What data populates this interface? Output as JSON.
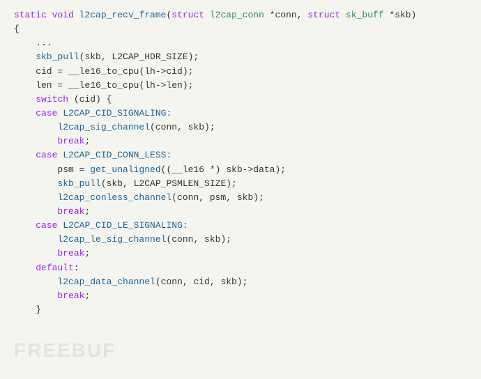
{
  "code": {
    "lines": [
      {
        "id": "line1",
        "tokens": [
          {
            "t": "static ",
            "c": "kw"
          },
          {
            "t": "void ",
            "c": "kw"
          },
          {
            "t": "l2cap_recv_frame",
            "c": "fn"
          },
          {
            "t": "(",
            "c": "plain"
          },
          {
            "t": "struct ",
            "c": "kw"
          },
          {
            "t": "l2cap_conn",
            "c": "type"
          },
          {
            "t": " *conn, ",
            "c": "plain"
          },
          {
            "t": "struct ",
            "c": "kw"
          },
          {
            "t": "sk_buff",
            "c": "type"
          },
          {
            "t": " *skb)",
            "c": "plain"
          }
        ]
      },
      {
        "id": "line2",
        "tokens": [
          {
            "t": "{",
            "c": "plain"
          }
        ]
      },
      {
        "id": "line3",
        "tokens": [
          {
            "t": "    ...",
            "c": "plain"
          }
        ]
      },
      {
        "id": "line4",
        "tokens": [
          {
            "t": "    skb_pull",
            "c": "fn"
          },
          {
            "t": "(skb, L2CAP_HDR_SIZE);",
            "c": "plain"
          }
        ]
      },
      {
        "id": "line5",
        "tokens": [
          {
            "t": "    cid = __le16_to_cpu",
            "c": "plain"
          },
          {
            "t": "(lh->cid);",
            "c": "plain"
          }
        ]
      },
      {
        "id": "line6",
        "tokens": [
          {
            "t": "    len = __le16_to_cpu",
            "c": "plain"
          },
          {
            "t": "(lh->len);",
            "c": "plain"
          }
        ]
      },
      {
        "id": "line7",
        "tokens": [
          {
            "t": "",
            "c": "plain"
          }
        ]
      },
      {
        "id": "line8",
        "tokens": [
          {
            "t": "    ",
            "c": "plain"
          },
          {
            "t": "switch",
            "c": "kw"
          },
          {
            "t": " (cid) {",
            "c": "plain"
          }
        ]
      },
      {
        "id": "line9",
        "tokens": [
          {
            "t": "    ",
            "c": "plain"
          },
          {
            "t": "case",
            "c": "kw"
          },
          {
            "t": " L2CAP_CID_SIGNALING:",
            "c": "const"
          }
        ]
      },
      {
        "id": "line10",
        "tokens": [
          {
            "t": "        l2cap_sig_channel",
            "c": "fn"
          },
          {
            "t": "(conn, skb);",
            "c": "plain"
          }
        ]
      },
      {
        "id": "line11",
        "tokens": [
          {
            "t": "        ",
            "c": "plain"
          },
          {
            "t": "break",
            "c": "kw"
          },
          {
            "t": ";",
            "c": "plain"
          }
        ]
      },
      {
        "id": "line12",
        "tokens": [
          {
            "t": "",
            "c": "plain"
          }
        ]
      },
      {
        "id": "line13",
        "tokens": [
          {
            "t": "    ",
            "c": "plain"
          },
          {
            "t": "case",
            "c": "kw"
          },
          {
            "t": " L2CAP_CID_CONN_LESS:",
            "c": "const"
          }
        ]
      },
      {
        "id": "line14",
        "tokens": [
          {
            "t": "        psm = ",
            "c": "plain"
          },
          {
            "t": "get_unaligned",
            "c": "fn"
          },
          {
            "t": "((__le16 *) skb->data);",
            "c": "plain"
          }
        ]
      },
      {
        "id": "line15",
        "tokens": [
          {
            "t": "        skb_pull",
            "c": "fn"
          },
          {
            "t": "(skb, L2CAP_PSMLEN_SIZE);",
            "c": "plain"
          }
        ]
      },
      {
        "id": "line16",
        "tokens": [
          {
            "t": "        l2cap_conless_channel",
            "c": "fn"
          },
          {
            "t": "(conn, psm, skb);",
            "c": "plain"
          }
        ]
      },
      {
        "id": "line17",
        "tokens": [
          {
            "t": "        ",
            "c": "plain"
          },
          {
            "t": "break",
            "c": "kw"
          },
          {
            "t": ";",
            "c": "plain"
          }
        ]
      },
      {
        "id": "line18",
        "tokens": [
          {
            "t": "",
            "c": "plain"
          }
        ]
      },
      {
        "id": "line19",
        "tokens": [
          {
            "t": "    ",
            "c": "plain"
          },
          {
            "t": "case",
            "c": "kw"
          },
          {
            "t": " L2CAP_CID_LE_SIGNALING:",
            "c": "const"
          }
        ]
      },
      {
        "id": "line20",
        "tokens": [
          {
            "t": "        l2cap_le_sig_channel",
            "c": "fn"
          },
          {
            "t": "(conn, skb);",
            "c": "plain"
          }
        ]
      },
      {
        "id": "line21",
        "tokens": [
          {
            "t": "        ",
            "c": "plain"
          },
          {
            "t": "break",
            "c": "kw"
          },
          {
            "t": ";",
            "c": "plain"
          }
        ]
      },
      {
        "id": "line22",
        "tokens": [
          {
            "t": "",
            "c": "plain"
          }
        ]
      },
      {
        "id": "line23",
        "tokens": [
          {
            "t": "    ",
            "c": "plain"
          },
          {
            "t": "default",
            "c": "kw"
          },
          {
            "t": ":",
            "c": "plain"
          }
        ]
      },
      {
        "id": "line24",
        "tokens": [
          {
            "t": "        l2cap_data_channel",
            "c": "fn"
          },
          {
            "t": "(conn, cid, skb);",
            "c": "plain"
          }
        ]
      },
      {
        "id": "line25",
        "tokens": [
          {
            "t": "        ",
            "c": "plain"
          },
          {
            "t": "break",
            "c": "kw"
          },
          {
            "t": ";",
            "c": "plain"
          }
        ]
      },
      {
        "id": "line26",
        "tokens": [
          {
            "t": "    }",
            "c": "plain"
          }
        ]
      }
    ],
    "watermark": "FREEBUF"
  }
}
